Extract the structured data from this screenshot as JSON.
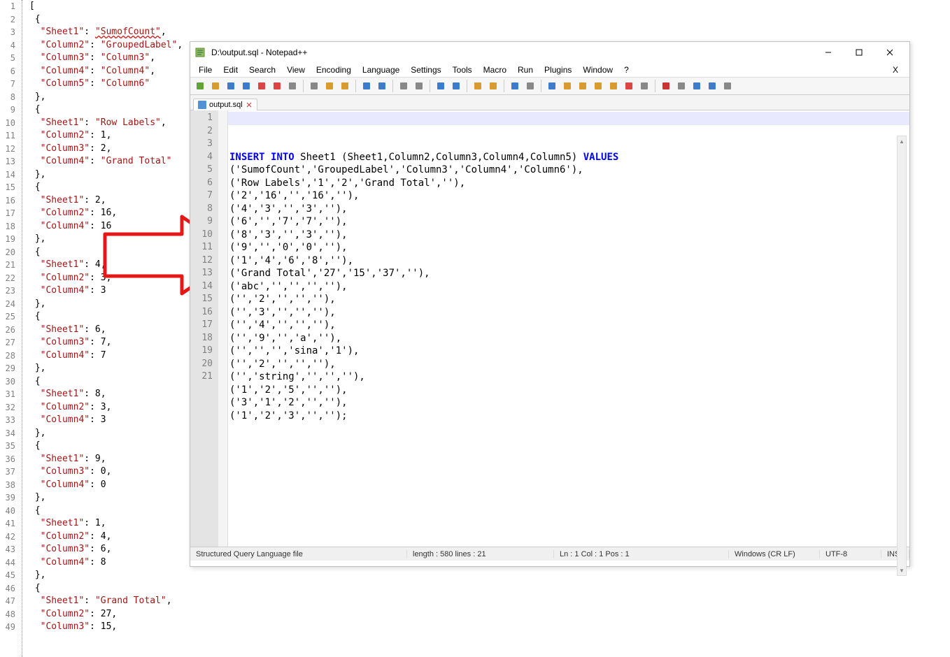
{
  "left_editor": {
    "lines": [
      {
        "n": 1,
        "tokens": [
          {
            "t": "[",
            "c": "tok-punc"
          }
        ]
      },
      {
        "n": 2,
        "tokens": [
          {
            "t": " {",
            "c": "tok-punc"
          }
        ]
      },
      {
        "n": 3,
        "tokens": [
          {
            "t": "  \"Sheet1\"",
            "c": "tok-key"
          },
          {
            "t": ": ",
            "c": "tok-punc"
          },
          {
            "t": "\"SumofCount\"",
            "c": "tok-str tok-redsq"
          },
          {
            "t": ",",
            "c": "tok-punc"
          }
        ]
      },
      {
        "n": 4,
        "tokens": [
          {
            "t": "  \"Column2\"",
            "c": "tok-key"
          },
          {
            "t": ": ",
            "c": "tok-punc"
          },
          {
            "t": "\"GroupedLabel\"",
            "c": "tok-str"
          },
          {
            "t": ",",
            "c": "tok-punc"
          }
        ]
      },
      {
        "n": 5,
        "tokens": [
          {
            "t": "  \"Column3\"",
            "c": "tok-key"
          },
          {
            "t": ": ",
            "c": "tok-punc"
          },
          {
            "t": "\"Column3\"",
            "c": "tok-str"
          },
          {
            "t": ",",
            "c": "tok-punc"
          }
        ]
      },
      {
        "n": 6,
        "tokens": [
          {
            "t": "  \"Column4\"",
            "c": "tok-key"
          },
          {
            "t": ": ",
            "c": "tok-punc"
          },
          {
            "t": "\"Column4\"",
            "c": "tok-str"
          },
          {
            "t": ",",
            "c": "tok-punc"
          }
        ]
      },
      {
        "n": 7,
        "tokens": [
          {
            "t": "  \"Column5\"",
            "c": "tok-key"
          },
          {
            "t": ": ",
            "c": "tok-punc"
          },
          {
            "t": "\"Column6\"",
            "c": "tok-str"
          }
        ]
      },
      {
        "n": 8,
        "tokens": [
          {
            "t": " },",
            "c": "tok-punc"
          }
        ]
      },
      {
        "n": 9,
        "tokens": [
          {
            "t": " {",
            "c": "tok-punc"
          }
        ]
      },
      {
        "n": 10,
        "tokens": [
          {
            "t": "  \"Sheet1\"",
            "c": "tok-key"
          },
          {
            "t": ": ",
            "c": "tok-punc"
          },
          {
            "t": "\"Row Labels\"",
            "c": "tok-str"
          },
          {
            "t": ",",
            "c": "tok-punc"
          }
        ]
      },
      {
        "n": 11,
        "tokens": [
          {
            "t": "  \"Column2\"",
            "c": "tok-key"
          },
          {
            "t": ": 1,",
            "c": "tok-punc"
          }
        ]
      },
      {
        "n": 12,
        "tokens": [
          {
            "t": "  \"Column3\"",
            "c": "tok-key"
          },
          {
            "t": ": 2,",
            "c": "tok-punc"
          }
        ]
      },
      {
        "n": 13,
        "tokens": [
          {
            "t": "  \"Column4\"",
            "c": "tok-key"
          },
          {
            "t": ": ",
            "c": "tok-punc"
          },
          {
            "t": "\"Grand Total\"",
            "c": "tok-str"
          }
        ]
      },
      {
        "n": 14,
        "tokens": [
          {
            "t": " },",
            "c": "tok-punc"
          }
        ]
      },
      {
        "n": 15,
        "tokens": [
          {
            "t": " {",
            "c": "tok-punc"
          }
        ]
      },
      {
        "n": 16,
        "tokens": [
          {
            "t": "  \"Sheet1\"",
            "c": "tok-key"
          },
          {
            "t": ": 2,",
            "c": "tok-punc"
          }
        ]
      },
      {
        "n": 17,
        "tokens": [
          {
            "t": "  \"Column2\"",
            "c": "tok-key"
          },
          {
            "t": ": 16,",
            "c": "tok-punc"
          }
        ]
      },
      {
        "n": 18,
        "tokens": [
          {
            "t": "  \"Column4\"",
            "c": "tok-key"
          },
          {
            "t": ": 16",
            "c": "tok-punc"
          }
        ]
      },
      {
        "n": 19,
        "tokens": [
          {
            "t": " },",
            "c": "tok-punc"
          }
        ]
      },
      {
        "n": 20,
        "tokens": [
          {
            "t": " {",
            "c": "tok-punc"
          }
        ]
      },
      {
        "n": 21,
        "tokens": [
          {
            "t": "  \"Sheet1\"",
            "c": "tok-key"
          },
          {
            "t": ": 4,",
            "c": "tok-punc"
          }
        ]
      },
      {
        "n": 22,
        "tokens": [
          {
            "t": "  \"Column2\"",
            "c": "tok-key"
          },
          {
            "t": ": 3,",
            "c": "tok-punc"
          }
        ]
      },
      {
        "n": 23,
        "tokens": [
          {
            "t": "  \"Column4\"",
            "c": "tok-key"
          },
          {
            "t": ": 3",
            "c": "tok-punc"
          }
        ]
      },
      {
        "n": 24,
        "tokens": [
          {
            "t": " },",
            "c": "tok-punc"
          }
        ]
      },
      {
        "n": 25,
        "tokens": [
          {
            "t": " {",
            "c": "tok-punc"
          }
        ]
      },
      {
        "n": 26,
        "tokens": [
          {
            "t": "  \"Sheet1\"",
            "c": "tok-key"
          },
          {
            "t": ": 6,",
            "c": "tok-punc"
          }
        ]
      },
      {
        "n": 27,
        "tokens": [
          {
            "t": "  \"Column3\"",
            "c": "tok-key"
          },
          {
            "t": ": 7,",
            "c": "tok-punc"
          }
        ]
      },
      {
        "n": 28,
        "tokens": [
          {
            "t": "  \"Column4\"",
            "c": "tok-key"
          },
          {
            "t": ": 7",
            "c": "tok-punc"
          }
        ]
      },
      {
        "n": 29,
        "tokens": [
          {
            "t": " },",
            "c": "tok-punc"
          }
        ]
      },
      {
        "n": 30,
        "tokens": [
          {
            "t": " {",
            "c": "tok-punc"
          }
        ]
      },
      {
        "n": 31,
        "tokens": [
          {
            "t": "  \"Sheet1\"",
            "c": "tok-key"
          },
          {
            "t": ": 8,",
            "c": "tok-punc"
          }
        ]
      },
      {
        "n": 32,
        "tokens": [
          {
            "t": "  \"Column2\"",
            "c": "tok-key"
          },
          {
            "t": ": 3,",
            "c": "tok-punc"
          }
        ]
      },
      {
        "n": 33,
        "tokens": [
          {
            "t": "  \"Column4\"",
            "c": "tok-key"
          },
          {
            "t": ": 3",
            "c": "tok-punc"
          }
        ]
      },
      {
        "n": 34,
        "tokens": [
          {
            "t": " },",
            "c": "tok-punc"
          }
        ]
      },
      {
        "n": 35,
        "tokens": [
          {
            "t": " {",
            "c": "tok-punc"
          }
        ]
      },
      {
        "n": 36,
        "tokens": [
          {
            "t": "  \"Sheet1\"",
            "c": "tok-key"
          },
          {
            "t": ": 9,",
            "c": "tok-punc"
          }
        ]
      },
      {
        "n": 37,
        "tokens": [
          {
            "t": "  \"Column3\"",
            "c": "tok-key"
          },
          {
            "t": ": 0,",
            "c": "tok-punc"
          }
        ]
      },
      {
        "n": 38,
        "tokens": [
          {
            "t": "  \"Column4\"",
            "c": "tok-key"
          },
          {
            "t": ": 0",
            "c": "tok-punc"
          }
        ]
      },
      {
        "n": 39,
        "tokens": [
          {
            "t": " },",
            "c": "tok-punc"
          }
        ]
      },
      {
        "n": 40,
        "tokens": [
          {
            "t": " {",
            "c": "tok-punc"
          }
        ]
      },
      {
        "n": 41,
        "tokens": [
          {
            "t": "  \"Sheet1\"",
            "c": "tok-key"
          },
          {
            "t": ": 1,",
            "c": "tok-punc"
          }
        ]
      },
      {
        "n": 42,
        "tokens": [
          {
            "t": "  \"Column2\"",
            "c": "tok-key"
          },
          {
            "t": ": 4,",
            "c": "tok-punc"
          }
        ]
      },
      {
        "n": 43,
        "tokens": [
          {
            "t": "  \"Column3\"",
            "c": "tok-key"
          },
          {
            "t": ": 6,",
            "c": "tok-punc"
          }
        ]
      },
      {
        "n": 44,
        "tokens": [
          {
            "t": "  \"Column4\"",
            "c": "tok-key"
          },
          {
            "t": ": 8",
            "c": "tok-punc"
          }
        ]
      },
      {
        "n": 45,
        "tokens": [
          {
            "t": " },",
            "c": "tok-punc"
          }
        ]
      },
      {
        "n": 46,
        "tokens": [
          {
            "t": " {",
            "c": "tok-punc"
          }
        ]
      },
      {
        "n": 47,
        "tokens": [
          {
            "t": "  \"Sheet1\"",
            "c": "tok-key"
          },
          {
            "t": ": ",
            "c": "tok-punc"
          },
          {
            "t": "\"Grand Total\"",
            "c": "tok-str"
          },
          {
            "t": ",",
            "c": "tok-punc"
          }
        ]
      },
      {
        "n": 48,
        "tokens": [
          {
            "t": "  \"Column2\"",
            "c": "tok-key"
          },
          {
            "t": ": 27,",
            "c": "tok-punc"
          }
        ]
      },
      {
        "n": 49,
        "tokens": [
          {
            "t": "  \"Column3\"",
            "c": "tok-key"
          },
          {
            "t": ": 15,",
            "c": "tok-punc"
          }
        ]
      }
    ]
  },
  "npp": {
    "title": "D:\\output.sql - Notepad++",
    "menus": [
      "File",
      "Edit",
      "Search",
      "View",
      "Encoding",
      "Language",
      "Settings",
      "Tools",
      "Macro",
      "Run",
      "Plugins",
      "Window",
      "?"
    ],
    "tab": {
      "label": "output.sql"
    },
    "toolbar_icons": [
      {
        "name": "new-icon",
        "color": "#5fa33a"
      },
      {
        "name": "open-icon",
        "color": "#d89b2d"
      },
      {
        "name": "save-icon",
        "color": "#3b7dcc"
      },
      {
        "name": "save-all-icon",
        "color": "#3b7dcc"
      },
      {
        "name": "close-icon",
        "color": "#d44"
      },
      {
        "name": "close-all-icon",
        "color": "#d44"
      },
      {
        "name": "print-icon",
        "color": "#888"
      },
      {
        "name": "sep"
      },
      {
        "name": "cut-icon",
        "color": "#888"
      },
      {
        "name": "copy-icon",
        "color": "#d89b2d"
      },
      {
        "name": "paste-icon",
        "color": "#d89b2d"
      },
      {
        "name": "sep"
      },
      {
        "name": "undo-icon",
        "color": "#3b7dcc"
      },
      {
        "name": "redo-icon",
        "color": "#3b7dcc"
      },
      {
        "name": "sep"
      },
      {
        "name": "find-icon",
        "color": "#888"
      },
      {
        "name": "replace-icon",
        "color": "#888"
      },
      {
        "name": "sep"
      },
      {
        "name": "zoom-in-icon",
        "color": "#3b7dcc"
      },
      {
        "name": "zoom-out-icon",
        "color": "#3b7dcc"
      },
      {
        "name": "sep"
      },
      {
        "name": "sync-v-icon",
        "color": "#d89b2d"
      },
      {
        "name": "sync-h-icon",
        "color": "#d89b2d"
      },
      {
        "name": "sep"
      },
      {
        "name": "wrap-icon",
        "color": "#3b7dcc"
      },
      {
        "name": "all-chars-icon",
        "color": "#888"
      },
      {
        "name": "sep"
      },
      {
        "name": "indent-icon",
        "color": "#3b7dcc"
      },
      {
        "name": "doc-map-icon",
        "color": "#d89b2d"
      },
      {
        "name": "doc-list-icon",
        "color": "#d89b2d"
      },
      {
        "name": "func-list-icon",
        "color": "#d89b2d"
      },
      {
        "name": "folder-icon",
        "color": "#d89b2d"
      },
      {
        "name": "monitoring-icon",
        "color": "#d44"
      },
      {
        "name": "show-icon",
        "color": "#888"
      },
      {
        "name": "sep"
      },
      {
        "name": "record-icon",
        "color": "#c33"
      },
      {
        "name": "stop-icon",
        "color": "#888"
      },
      {
        "name": "play-icon",
        "color": "#3b7dcc"
      },
      {
        "name": "play-multi-icon",
        "color": "#3b7dcc"
      },
      {
        "name": "save-macro-icon",
        "color": "#888"
      }
    ],
    "code_lines": [
      {
        "n": 1,
        "segments": [
          {
            "t": "INSERT",
            "c": "kw-blue"
          },
          {
            "t": " "
          },
          {
            "t": "INTO",
            "c": "kw-blue"
          },
          {
            "t": " Sheet1 (Sheet1,Column2,Column3,Column4,Column5) "
          },
          {
            "t": "VALUES",
            "c": "kw-blue"
          }
        ]
      },
      {
        "n": 2,
        "plain": "('SumofCount','GroupedLabel','Column3','Column4','Column6'),"
      },
      {
        "n": 3,
        "plain": "('Row Labels','1','2','Grand Total',''),"
      },
      {
        "n": 4,
        "plain": "('2','16','','16',''),"
      },
      {
        "n": 5,
        "plain": "('4','3','','3',''),"
      },
      {
        "n": 6,
        "plain": "('6','','7','7',''),"
      },
      {
        "n": 7,
        "plain": "('8','3','','3',''),"
      },
      {
        "n": 8,
        "plain": "('9','','0','0',''),"
      },
      {
        "n": 9,
        "plain": "('1','4','6','8',''),"
      },
      {
        "n": 10,
        "plain": "('Grand Total','27','15','37',''),"
      },
      {
        "n": 11,
        "plain": "('abc','','','',''),"
      },
      {
        "n": 12,
        "plain": "('','2','','',''),"
      },
      {
        "n": 13,
        "plain": "('','3','','',''),"
      },
      {
        "n": 14,
        "plain": "('','4','','',''),"
      },
      {
        "n": 15,
        "plain": "('','9','','a',''),"
      },
      {
        "n": 16,
        "plain": "('','','','sina','1'),"
      },
      {
        "n": 17,
        "plain": "('','2','','',''),"
      },
      {
        "n": 18,
        "plain": "('','string','','',''),"
      },
      {
        "n": 19,
        "plain": "('1','2','5','',''),"
      },
      {
        "n": 20,
        "plain": "('3','1','2','',''),"
      },
      {
        "n": 21,
        "plain": "('1','2','3','','');"
      }
    ],
    "status": {
      "lang": "Structured Query Language file",
      "length": "length : 580    lines : 21",
      "pos": "Ln : 1    Col : 1    Pos : 1",
      "eol": "Windows (CR LF)",
      "enc": "UTF-8",
      "ins": "INS"
    }
  }
}
